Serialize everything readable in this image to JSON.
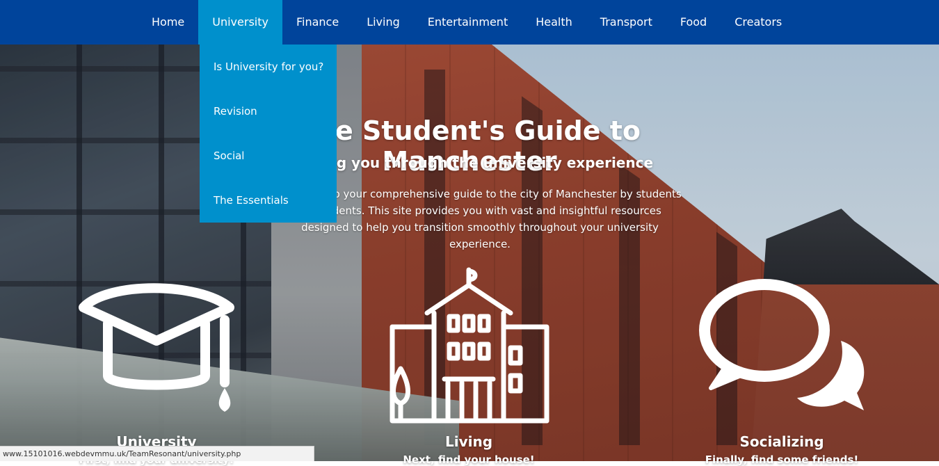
{
  "nav": {
    "items": [
      {
        "label": "Home",
        "active": false
      },
      {
        "label": "University",
        "active": true
      },
      {
        "label": "Finance",
        "active": false
      },
      {
        "label": "Living",
        "active": false
      },
      {
        "label": "Entertainment",
        "active": false
      },
      {
        "label": "Health",
        "active": false
      },
      {
        "label": "Transport",
        "active": false
      },
      {
        "label": "Food",
        "active": false
      },
      {
        "label": "Creators",
        "active": false
      }
    ]
  },
  "dropdown": {
    "items": [
      {
        "label": "Is University for you?"
      },
      {
        "label": "Revision"
      },
      {
        "label": "Social"
      },
      {
        "label": "The Essentials"
      }
    ]
  },
  "hero": {
    "title": "The Student's Guide to Manchester",
    "subtitle": "Guiding you through the university experience",
    "description": "Welcome to your comprehensive guide to the city of Manchester by students for students. This site provides you with vast and insightful resources designed to help you transition smoothly throughout your university experience."
  },
  "features": [
    {
      "title": "University",
      "caption": "First, find your university!",
      "icon": "graduation-cap-icon"
    },
    {
      "title": "Living",
      "caption": "Next, find your house!",
      "icon": "building-icon"
    },
    {
      "title": "Socializing",
      "caption": "Finally, find some friends!",
      "icon": "speech-bubbles-icon"
    }
  ],
  "status": {
    "url": "www.15101016.webdevmmu.uk/TeamResonant/university.php"
  },
  "colors": {
    "nav_bg": "#00449b",
    "active_bg": "#0090cc",
    "dropdown_bg": "#0090cc"
  }
}
